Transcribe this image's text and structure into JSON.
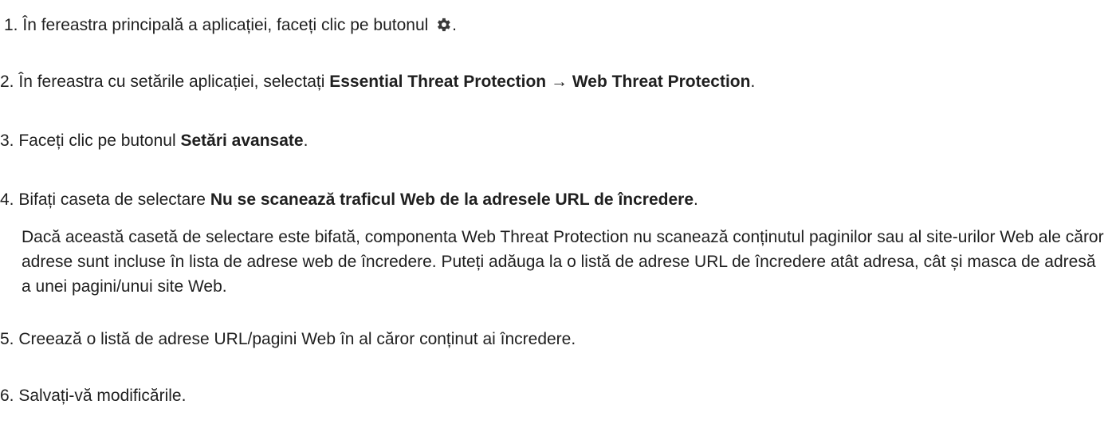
{
  "steps": [
    {
      "number": "1.",
      "text_before": "În fereastra principală a aplicației, faceți clic pe butonul",
      "icon": "gear-icon",
      "text_after": "."
    },
    {
      "number": "2.",
      "text_before": "În fereastra cu setările aplicației, selectați",
      "bold_1": "Essential Threat Protection",
      "arrow": "→",
      "bold_2": "Web Threat Protection",
      "text_after": "."
    },
    {
      "number": "3.",
      "text_before": "Faceți clic pe butonul",
      "bold_1": "Setări avansate",
      "text_after": "."
    },
    {
      "number": "4.",
      "text_before": "Bifați caseta de selectare",
      "bold_1": "Nu se scanează traficul Web de la adresele URL de încredere",
      "text_after": ".",
      "note": "Dacă această casetă de selectare este bifată, componenta Web Threat Protection nu scanează conținutul paginilor sau al site-urilor Web ale căror adrese sunt incluse în lista de adrese web de încredere. Puteți adăuga la o listă de adrese URL de încredere atât adresa, cât și masca de adresă a unei pagini/unui site Web."
    },
    {
      "number": "5.",
      "text": "Creează o listă de adrese URL/pagini Web în al căror conținut ai încredere."
    },
    {
      "number": "6.",
      "text": "Salvați-vă modificările."
    }
  ]
}
